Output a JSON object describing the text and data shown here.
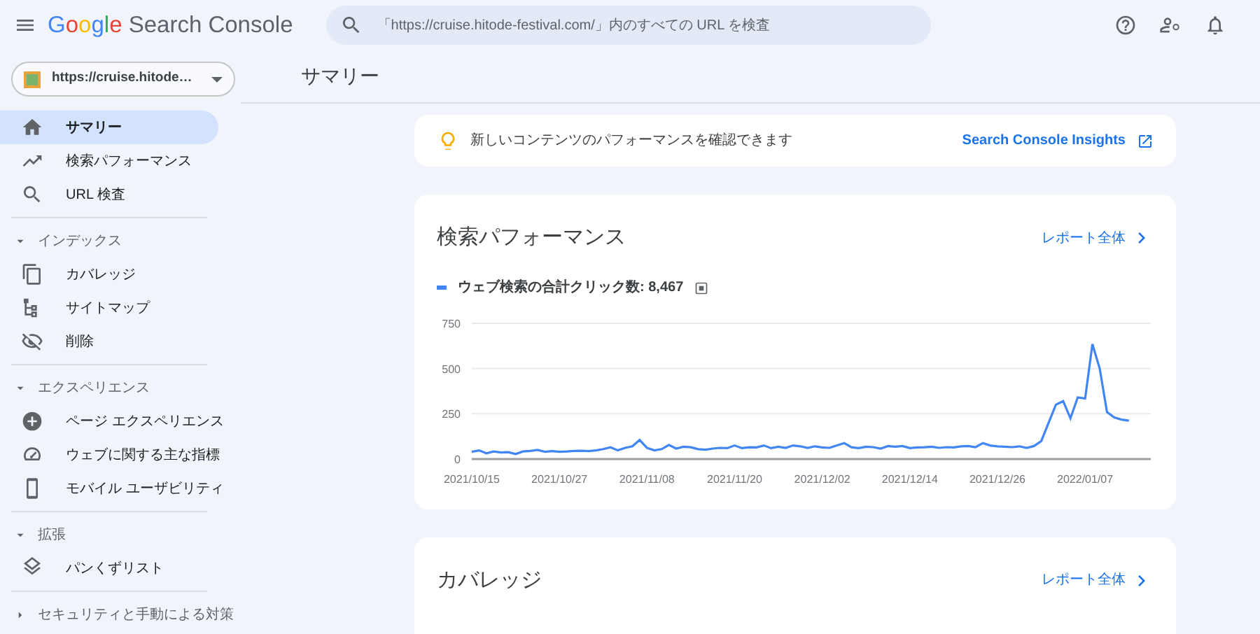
{
  "topbar": {
    "logo": {
      "brand": "Google",
      "product": "Search Console"
    },
    "search": {
      "placeholder": "「https://cruise.hitode-festival.com/」内のすべての URL を検査"
    }
  },
  "sidebar": {
    "property": "https://cruise.hitode…",
    "items": [
      {
        "kind": "link",
        "label": "サマリー",
        "selected": true
      },
      {
        "kind": "link",
        "label": "検索パフォーマンス",
        "selected": false
      },
      {
        "kind": "link",
        "label": "URL 検査",
        "selected": false
      },
      {
        "kind": "section",
        "label": "インデックス",
        "expanded": true,
        "children": [
          {
            "label": "カバレッジ",
            "selected": false
          },
          {
            "label": "サイトマップ",
            "selected": false
          },
          {
            "label": "削除",
            "selected": false
          }
        ]
      },
      {
        "kind": "section",
        "label": "エクスペリエンス",
        "expanded": true,
        "children": [
          {
            "label": "ページ エクスペリエンス",
            "selected": false
          },
          {
            "label": "ウェブに関する主な指標",
            "selected": false
          },
          {
            "label": "モバイル ユーザビリティ",
            "selected": false
          }
        ]
      },
      {
        "kind": "section",
        "label": "拡張",
        "expanded": true,
        "children": [
          {
            "label": "パンくずリスト",
            "selected": false
          }
        ]
      },
      {
        "kind": "section",
        "label": "セキュリティと手動による対策",
        "expanded": false
      }
    ]
  },
  "page_title": "サマリー",
  "insight": {
    "text": "新しいコンテンツのパフォーマンスを確認できます",
    "link": "Search Console Insights"
  },
  "cards": [
    {
      "title": "検索パフォーマンス",
      "link": "レポート全体",
      "legend": "ウェブ検索の合計クリック数: 8,467",
      "chart_data": {
        "type": "line",
        "ylim": [
          0,
          750
        ],
        "categories": [
          "2021/10/15",
          null,
          null,
          null,
          null,
          null,
          null,
          null,
          null,
          null,
          null,
          null,
          "2021/10/27",
          null,
          null,
          null,
          null,
          null,
          null,
          null,
          null,
          null,
          null,
          null,
          "2021/11/08",
          null,
          null,
          null,
          null,
          null,
          null,
          null,
          null,
          null,
          null,
          null,
          "2021/11/20",
          null,
          null,
          null,
          null,
          null,
          null,
          null,
          null,
          null,
          null,
          null,
          "2021/12/02",
          null,
          null,
          null,
          null,
          null,
          null,
          null,
          null,
          null,
          null,
          null,
          "2021/12/14",
          null,
          null,
          null,
          null,
          null,
          null,
          null,
          null,
          null,
          null,
          null,
          "2021/12/26",
          null,
          null,
          null,
          null,
          null,
          null,
          null,
          null,
          null,
          null,
          null,
          "2022/01/07",
          null,
          null,
          null,
          null,
          null,
          null
        ],
        "yticks": [
          0,
          250,
          500,
          750
        ],
        "series": [
          {
            "color": "#4285f4",
            "values": [
              40,
              48,
              32,
              42,
              36,
              38,
              28,
              42,
              45,
              50,
              40,
              44,
              40,
              42,
              45,
              46,
              44,
              48,
              55,
              65,
              48,
              62,
              70,
              105,
              62,
              48,
              55,
              78,
              58,
              68,
              65,
              55,
              52,
              58,
              62,
              60,
              75,
              60,
              65,
              64,
              75,
              60,
              68,
              62,
              75,
              70,
              62,
              70,
              64,
              62,
              75,
              88,
              65,
              60,
              68,
              66,
              58,
              72,
              68,
              72,
              60,
              64,
              65,
              68,
              62,
              66,
              64,
              70,
              72,
              66,
              88,
              75,
              70,
              68,
              66,
              70,
              62,
              72,
              100,
              200,
              300,
              320,
              225,
              340,
              335,
              635,
              500,
              260,
              230,
              218,
              212
            ]
          }
        ]
      }
    },
    {
      "title": "カバレッジ",
      "link": "レポート全体"
    }
  ]
}
